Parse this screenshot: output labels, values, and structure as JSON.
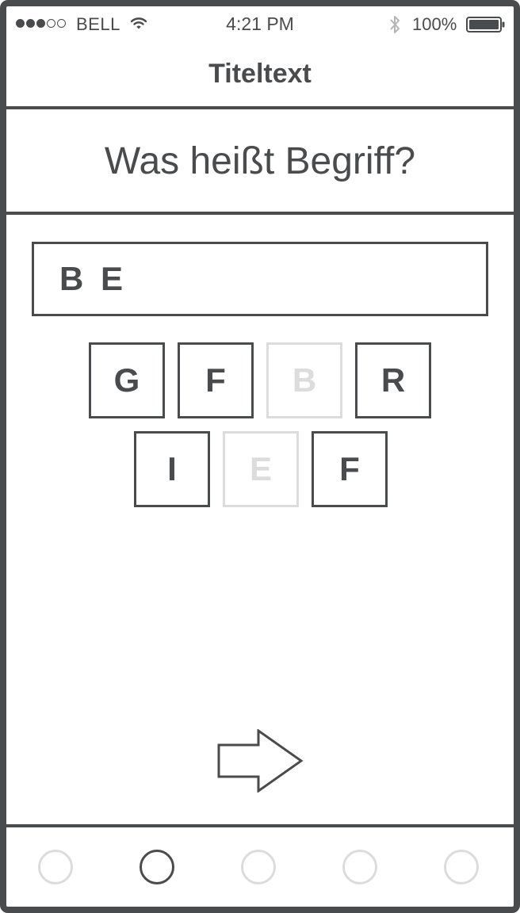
{
  "status_bar": {
    "carrier": "BELL",
    "time": "4:21 PM",
    "battery_percent": "100%",
    "signal_bars_filled": 3,
    "signal_bars_total": 5
  },
  "header": {
    "title": "Titeltext"
  },
  "quiz": {
    "question": "Was heißt Begriff?",
    "answer": "B E",
    "tiles_row1": [
      {
        "letter": "G",
        "used": false
      },
      {
        "letter": "F",
        "used": false
      },
      {
        "letter": "B",
        "used": true
      },
      {
        "letter": "R",
        "used": false
      }
    ],
    "tiles_row2": [
      {
        "letter": "I",
        "used": false
      },
      {
        "letter": "E",
        "used": true
      },
      {
        "letter": "F",
        "used": false
      }
    ]
  },
  "pager": {
    "count": 5,
    "active_index": 1
  },
  "colors": {
    "ink": "#4a4b4d",
    "muted": "#dcdcdc",
    "background": "#ffffff"
  }
}
